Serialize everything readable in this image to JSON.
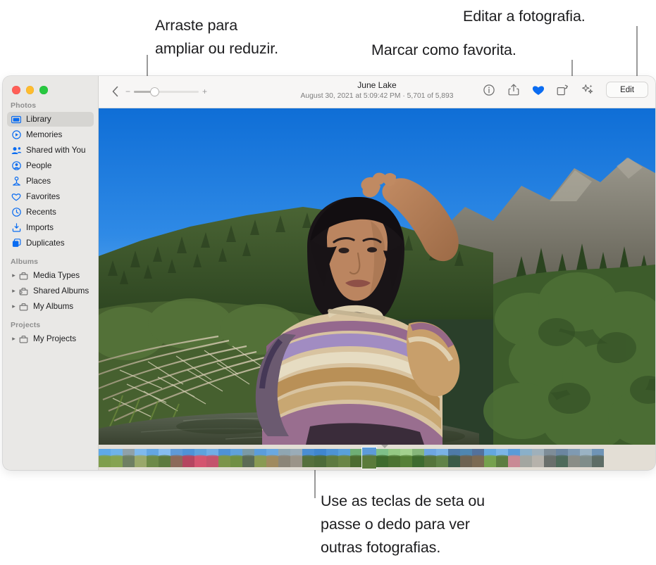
{
  "callouts": [
    {
      "id": "zoom",
      "text": "Arraste para\nampliar ou reduzir."
    },
    {
      "id": "fav",
      "text": "Marcar como favorita."
    },
    {
      "id": "edit",
      "text": "Editar a fotografia."
    },
    {
      "id": "arrow",
      "text": "Use as teclas de seta ou\npasse o dedo para ver\noutras fotografias."
    }
  ],
  "window": {
    "traffic_lights": [
      "close",
      "minimize",
      "zoom"
    ]
  },
  "sidebar": {
    "sections": [
      {
        "header": "Photos",
        "items": [
          {
            "label": "Library",
            "icon": "library-icon",
            "selected": true,
            "disclosure": false
          },
          {
            "label": "Memories",
            "icon": "memories-icon",
            "selected": false,
            "disclosure": false
          },
          {
            "label": "Shared with You",
            "icon": "shared-with-you-icon",
            "selected": false,
            "disclosure": false
          },
          {
            "label": "People",
            "icon": "people-icon",
            "selected": false,
            "disclosure": false
          },
          {
            "label": "Places",
            "icon": "places-icon",
            "selected": false,
            "disclosure": false
          },
          {
            "label": "Favorites",
            "icon": "heart-icon",
            "selected": false,
            "disclosure": false
          },
          {
            "label": "Recents",
            "icon": "clock-icon",
            "selected": false,
            "disclosure": false
          },
          {
            "label": "Imports",
            "icon": "import-icon",
            "selected": false,
            "disclosure": false
          },
          {
            "label": "Duplicates",
            "icon": "duplicates-icon",
            "selected": false,
            "disclosure": false
          }
        ]
      },
      {
        "header": "Albums",
        "items": [
          {
            "label": "Media Types",
            "icon": "folder-icon",
            "selected": false,
            "disclosure": true
          },
          {
            "label": "Shared Albums",
            "icon": "shared-folder-icon",
            "selected": false,
            "disclosure": true
          },
          {
            "label": "My Albums",
            "icon": "folder-icon",
            "selected": false,
            "disclosure": true
          }
        ]
      },
      {
        "header": "Projects",
        "items": [
          {
            "label": "My Projects",
            "icon": "folder-icon",
            "selected": false,
            "disclosure": true
          }
        ]
      }
    ]
  },
  "toolbar": {
    "back_icon": "chevron-left-icon",
    "zoom_minus": "−",
    "zoom_plus": "+",
    "zoom_value": 32,
    "title": "June Lake",
    "subtitle": "August 30, 2021 at 5:09:42 PM  ·  5,701 of 5,893",
    "tools": [
      {
        "name": "info-icon",
        "glyph": "info"
      },
      {
        "name": "share-icon",
        "glyph": "share"
      },
      {
        "name": "favorite-icon",
        "glyph": "heart-filled",
        "active": true,
        "color": "#0a6cf1"
      },
      {
        "name": "rotate-icon",
        "glyph": "rotate"
      },
      {
        "name": "enhance-icon",
        "glyph": "wand"
      }
    ],
    "edit_label": "Edit"
  },
  "photo": {
    "alt": "Person in a striped sweater shading their eyes, standing by a river with trees and a mountain ridge under a clear blue sky",
    "sky_color": "#1e7fe0",
    "mountain_color": "#7c7a6e",
    "foliage_color": "#4c6a33",
    "water_color": "#4a5448"
  },
  "filmstrip": {
    "selected_index": 22,
    "marker": "selection-marker",
    "thumbs": [
      {
        "top": "#5fa9e8",
        "bottom": "#7f9e4b"
      },
      {
        "top": "#6fb3ea",
        "bottom": "#86a351"
      },
      {
        "top": "#8fa1a9",
        "bottom": "#6f7f62"
      },
      {
        "top": "#7fb9ec",
        "bottom": "#9aa86a"
      },
      {
        "top": "#63a6e2",
        "bottom": "#6d8a47"
      },
      {
        "top": "#86bdef",
        "bottom": "#5e7b3e"
      },
      {
        "top": "#5f9ad8",
        "bottom": "#8d6a58"
      },
      {
        "top": "#4f92d7",
        "bottom": "#b5465f"
      },
      {
        "top": "#5ea2dd",
        "bottom": "#d4556e"
      },
      {
        "top": "#71ade5",
        "bottom": "#c4546b"
      },
      {
        "top": "#4e92d6",
        "bottom": "#7d9449"
      },
      {
        "top": "#5fa1dc",
        "bottom": "#718f44"
      },
      {
        "top": "#7a9aa6",
        "bottom": "#5c6b55"
      },
      {
        "top": "#5b9ddb",
        "bottom": "#8a9a52"
      },
      {
        "top": "#6aa8e1",
        "bottom": "#a08a5e"
      },
      {
        "top": "#8fa6b2",
        "bottom": "#8b8577"
      },
      {
        "top": "#9aacb8",
        "bottom": "#9b9488"
      },
      {
        "top": "#4a8ed3",
        "bottom": "#56703c"
      },
      {
        "top": "#3f86cf",
        "bottom": "#4e6b38"
      },
      {
        "top": "#4d93d6",
        "bottom": "#5f7a3f"
      },
      {
        "top": "#59a0dc",
        "bottom": "#6b8544"
      },
      {
        "top": "#6fae76",
        "bottom": "#4d6c30"
      },
      {
        "top": "#5d9bd9",
        "bottom": "#5b7b3a"
      },
      {
        "top": "#7fc089",
        "bottom": "#3f6b2c"
      },
      {
        "top": "#95c884",
        "bottom": "#4c7230"
      },
      {
        "top": "#a4d18f",
        "bottom": "#568036"
      },
      {
        "top": "#86b67a",
        "bottom": "#3e6b2e"
      },
      {
        "top": "#6ea6e1",
        "bottom": "#55743a"
      },
      {
        "top": "#7ab2e6",
        "bottom": "#618347"
      },
      {
        "top": "#4e7aa8",
        "bottom": "#3c5a46"
      },
      {
        "top": "#4f86b0",
        "bottom": "#6e6250"
      },
      {
        "top": "#53719c",
        "bottom": "#7c6a52"
      },
      {
        "top": "#63a7de",
        "bottom": "#76a14d"
      },
      {
        "top": "#7bb5e7",
        "bottom": "#5d7d40"
      },
      {
        "top": "#5a9bd9",
        "bottom": "#c98a94"
      },
      {
        "top": "#8ab0c9",
        "bottom": "#a3a6a0"
      },
      {
        "top": "#9fb0bb",
        "bottom": "#b6b2ab"
      },
      {
        "top": "#7e8d98",
        "bottom": "#6a6f6b"
      },
      {
        "top": "#6b86a0",
        "bottom": "#4f6b5a"
      },
      {
        "top": "#7f9ab2",
        "bottom": "#8a8d86"
      },
      {
        "top": "#9ab3c4",
        "bottom": "#7f8d8a"
      },
      {
        "top": "#6f94b6",
        "bottom": "#5e6d66"
      }
    ]
  }
}
